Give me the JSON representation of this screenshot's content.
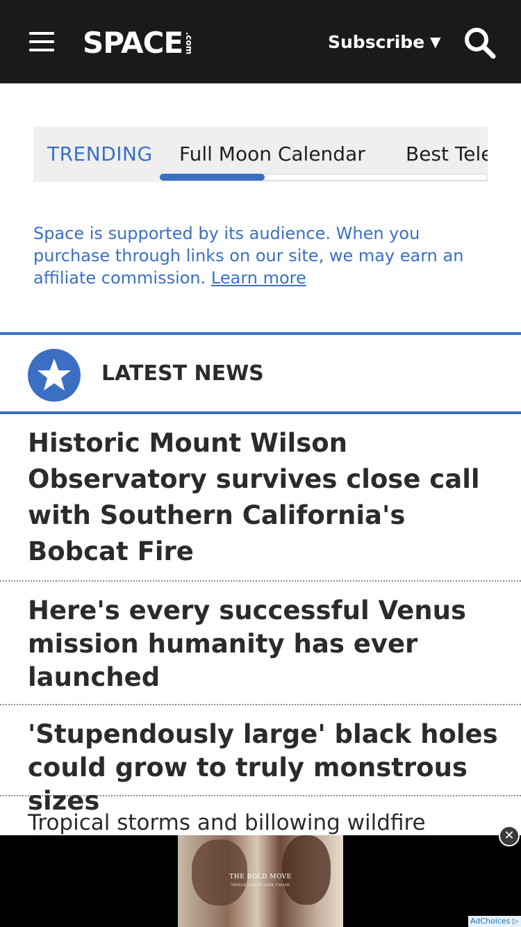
{
  "header": {
    "logo_main": "SPACE",
    "logo_sub": ".com",
    "subscribe_label": "Subscribe",
    "subscribe_caret": "▼"
  },
  "trending": {
    "label": "TRENDING",
    "links": [
      "Full Moon Calendar",
      "Best Tele"
    ],
    "scroll_position": 0.32
  },
  "affiliate": {
    "text": "Space is supported by its audience. When you purchase through links on our site, we may earn an affiliate commission.",
    "link_text": "Learn more"
  },
  "latest_news": {
    "title": "LATEST NEWS"
  },
  "news": [
    {
      "headline": "Historic Mount Wilson Observatory survives close call with Southern California's Bobcat Fire"
    },
    {
      "headline": "Here's every successful Venus mission humanity has ever launched"
    },
    {
      "headline": "'Stupendously large' black holes could grow to truly monstrous sizes"
    },
    {
      "headline": "Tropical storms and billowing wildfire"
    }
  ],
  "ad": {
    "headline": "THE BOLD MOVE",
    "subline": "TRIPLE CABLE LINK CHAIN",
    "close_symbol": "✕",
    "adchoices_label": "AdChoices"
  },
  "colors": {
    "header_bg": "#1a1a1a",
    "accent_blue": "#3a6fc4",
    "trending_bg": "#efefef"
  }
}
